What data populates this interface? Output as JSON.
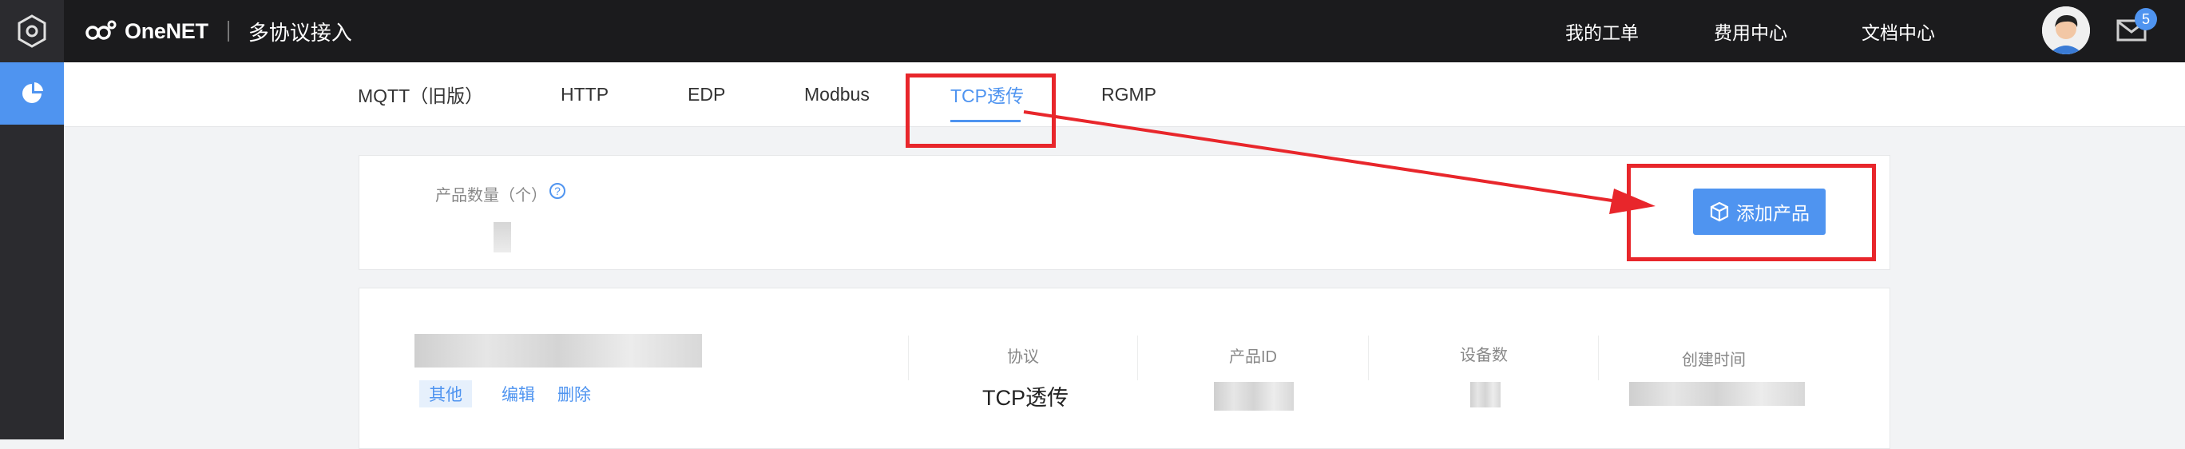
{
  "app": {
    "brand": "OneNET",
    "subtitle": "多协议接入"
  },
  "topnav": {
    "items": [
      "我的工单",
      "费用中心",
      "文档中心"
    ],
    "mail_badge": "5"
  },
  "tabs": [
    {
      "label": "MQTT（旧版）",
      "active": false
    },
    {
      "label": "HTTP",
      "active": false
    },
    {
      "label": "EDP",
      "active": false
    },
    {
      "label": "Modbus",
      "active": false
    },
    {
      "label": "TCP透传",
      "active": true
    },
    {
      "label": "RGMP",
      "active": false
    }
  ],
  "summary": {
    "count_label": "产品数量（个）",
    "help_icon": "question-circle-icon",
    "add_button": "添加产品"
  },
  "product": {
    "actions": [
      "其他",
      "编辑",
      "删除"
    ],
    "columns": [
      {
        "header": "协议",
        "value": "TCP透传"
      },
      {
        "header": "产品ID",
        "value": ""
      },
      {
        "header": "设备数",
        "value": ""
      },
      {
        "header": "创建时间",
        "value": ""
      }
    ]
  },
  "colors": {
    "accent": "#4f94f0",
    "annotation": "#e8262b",
    "topbar": "#1b1b1d"
  }
}
